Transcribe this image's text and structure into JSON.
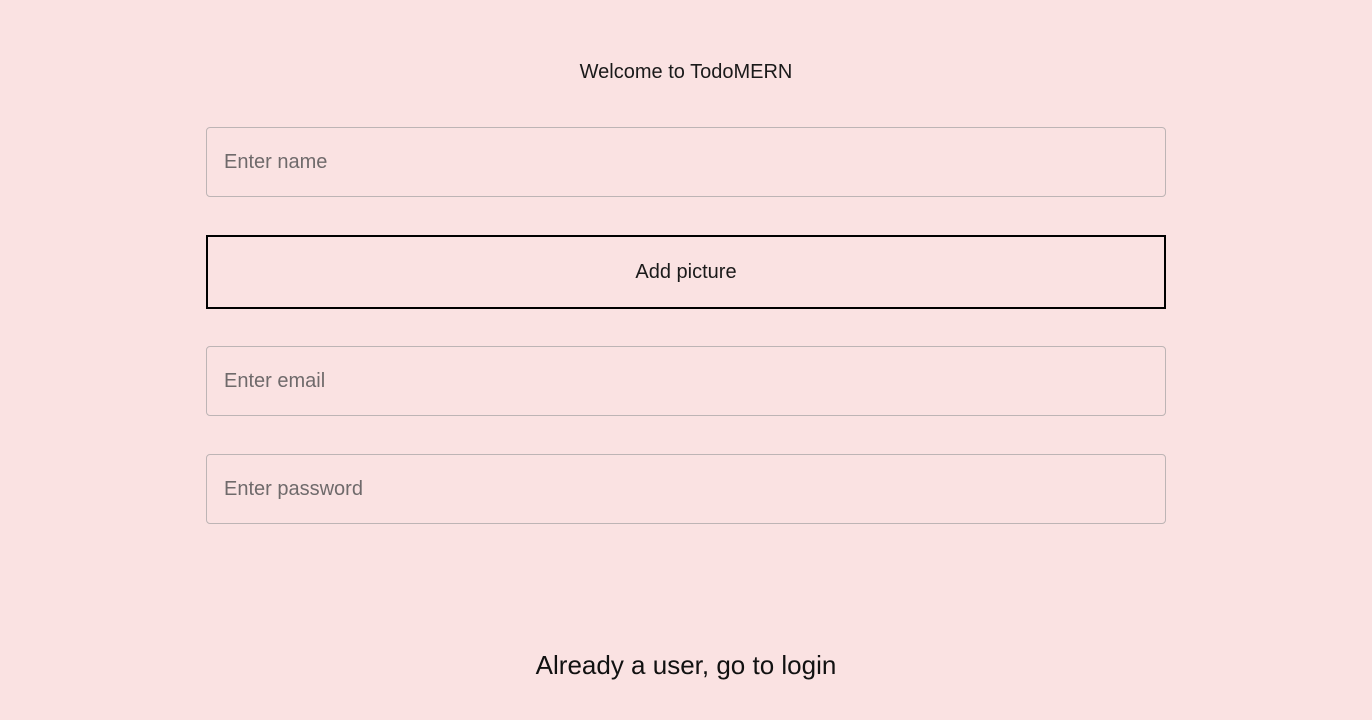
{
  "page": {
    "title": "Welcome to TodoMERN",
    "background_color": "#fae2e2"
  },
  "form": {
    "name_placeholder": "Enter name",
    "add_picture_label": "Add picture",
    "email_placeholder": "Enter email",
    "password_placeholder": "Enter password"
  },
  "footer": {
    "login_link_text": "Already a user, go to login"
  }
}
